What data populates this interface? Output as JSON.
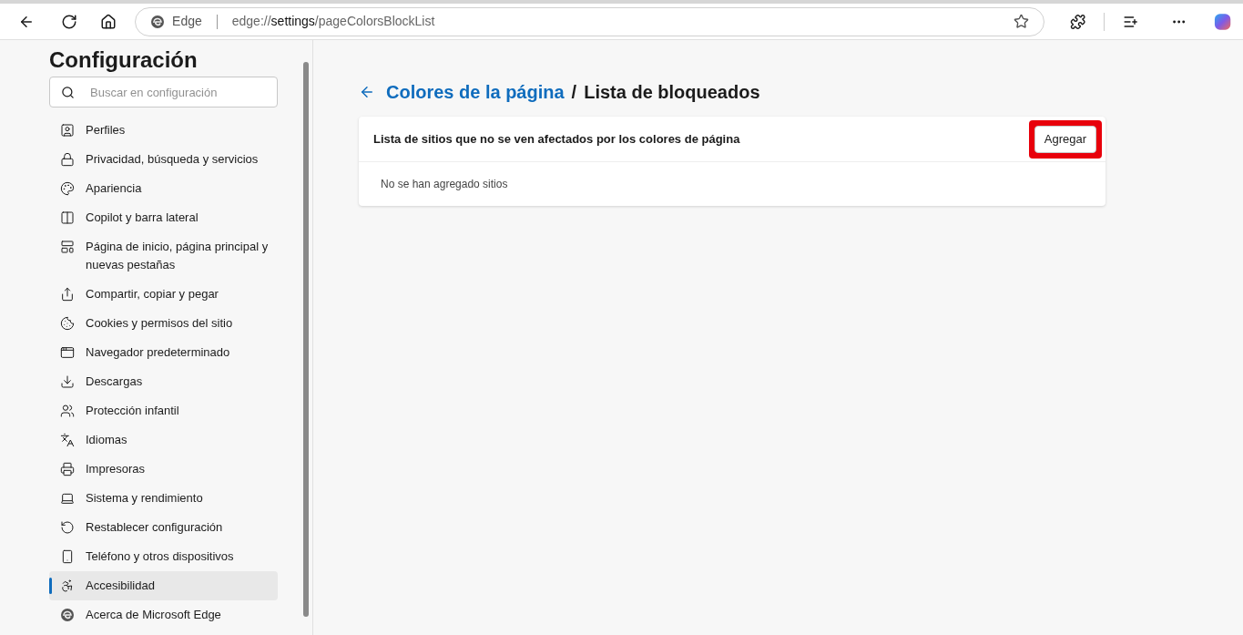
{
  "toolbar": {
    "site_label": "Edge",
    "url_scheme": "edge://",
    "url_host": "settings",
    "url_path": "/pageColorsBlockList"
  },
  "sidebar": {
    "title": "Configuración",
    "search": {
      "placeholder": "Buscar en configuración"
    },
    "items": [
      {
        "label": "Perfiles",
        "selected": false
      },
      {
        "label": "Privacidad, búsqueda y servicios",
        "selected": false
      },
      {
        "label": "Apariencia",
        "selected": false
      },
      {
        "label": "Copilot y barra lateral",
        "selected": false
      },
      {
        "label": "Página de inicio, página principal y nuevas pestañas",
        "selected": false
      },
      {
        "label": "Compartir, copiar y pegar",
        "selected": false
      },
      {
        "label": "Cookies y permisos del sitio",
        "selected": false
      },
      {
        "label": "Navegador predeterminado",
        "selected": false
      },
      {
        "label": "Descargas",
        "selected": false
      },
      {
        "label": "Protección infantil",
        "selected": false
      },
      {
        "label": "Idiomas",
        "selected": false
      },
      {
        "label": "Impresoras",
        "selected": false
      },
      {
        "label": "Sistema y rendimiento",
        "selected": false
      },
      {
        "label": "Restablecer configuración",
        "selected": false
      },
      {
        "label": "Teléfono y otros dispositivos",
        "selected": false
      },
      {
        "label": "Accesibilidad",
        "selected": true
      },
      {
        "label": "Acerca de Microsoft Edge",
        "selected": false
      }
    ]
  },
  "breadcrumb": {
    "parent": "Colores de la página",
    "separator": "/",
    "current": "Lista de bloqueados"
  },
  "card": {
    "heading": "Lista de sitios que no se ven afectados por los colores de página",
    "add_button": {
      "label": "Agregar",
      "highlighted": true
    },
    "empty_message": "No se han agregado sitios"
  }
}
